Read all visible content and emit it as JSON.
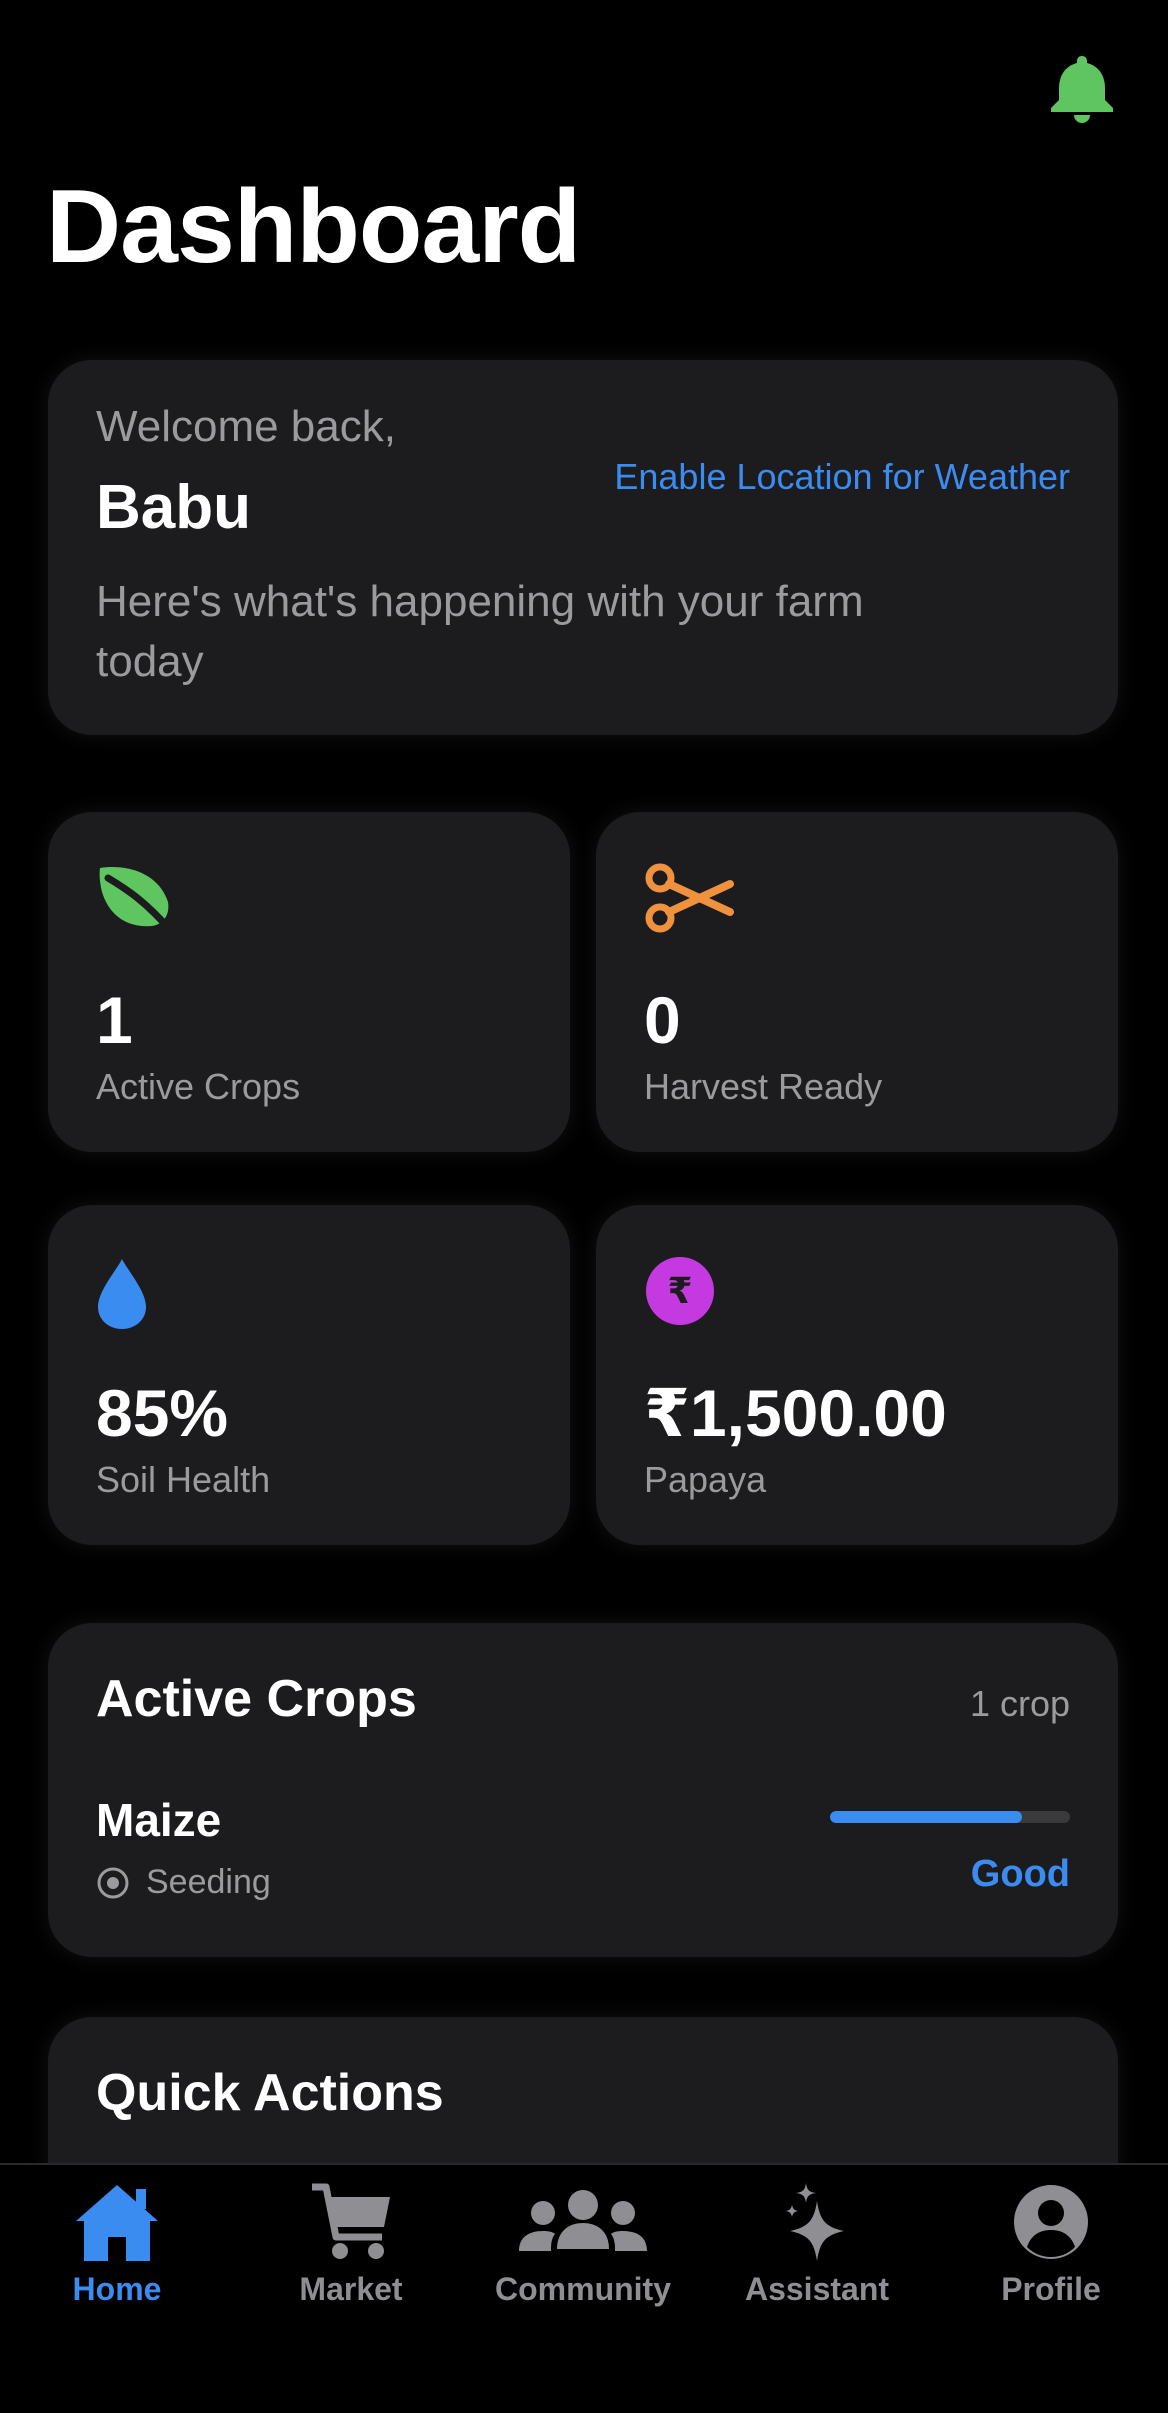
{
  "header": {
    "title": "Dashboard",
    "notification_icon": "bell-icon",
    "notification_color": "#5ec561"
  },
  "welcome": {
    "greeting": "Welcome back,",
    "name": "Babu",
    "location_link": "Enable Location for Weather",
    "subtitle": "Here's what's happening with your farm today"
  },
  "stats": [
    {
      "icon": "leaf-icon",
      "color": "#5ec561",
      "value": "1",
      "label": "Active Crops"
    },
    {
      "icon": "scissors-icon",
      "color": "#f0913e",
      "value": "0",
      "label": "Harvest Ready"
    },
    {
      "icon": "water-drop-icon",
      "color": "#3b8cf0",
      "value": "85%",
      "label": "Soil Health"
    },
    {
      "icon": "rupee-icon",
      "color": "#c53ae0",
      "value": "₹1,500.00",
      "label": "Papaya"
    }
  ],
  "active_crops": {
    "title": "Active Crops",
    "count": "1 crop",
    "items": [
      {
        "name": "Maize",
        "stage": "Seeding",
        "progress_fraction": 0.8,
        "rating": "Good"
      }
    ]
  },
  "quick_actions": {
    "title": "Quick Actions"
  },
  "tabbar": {
    "active_color": "#3b8cf0",
    "inactive_color": "#8e8e93",
    "tabs": [
      {
        "label": "Home",
        "icon": "home-icon",
        "active": true
      },
      {
        "label": "Market",
        "icon": "cart-icon",
        "active": false
      },
      {
        "label": "Community",
        "icon": "people-icon",
        "active": false
      },
      {
        "label": "Assistant",
        "icon": "sparkles-icon",
        "active": false
      },
      {
        "label": "Profile",
        "icon": "profile-icon",
        "active": false
      }
    ]
  }
}
